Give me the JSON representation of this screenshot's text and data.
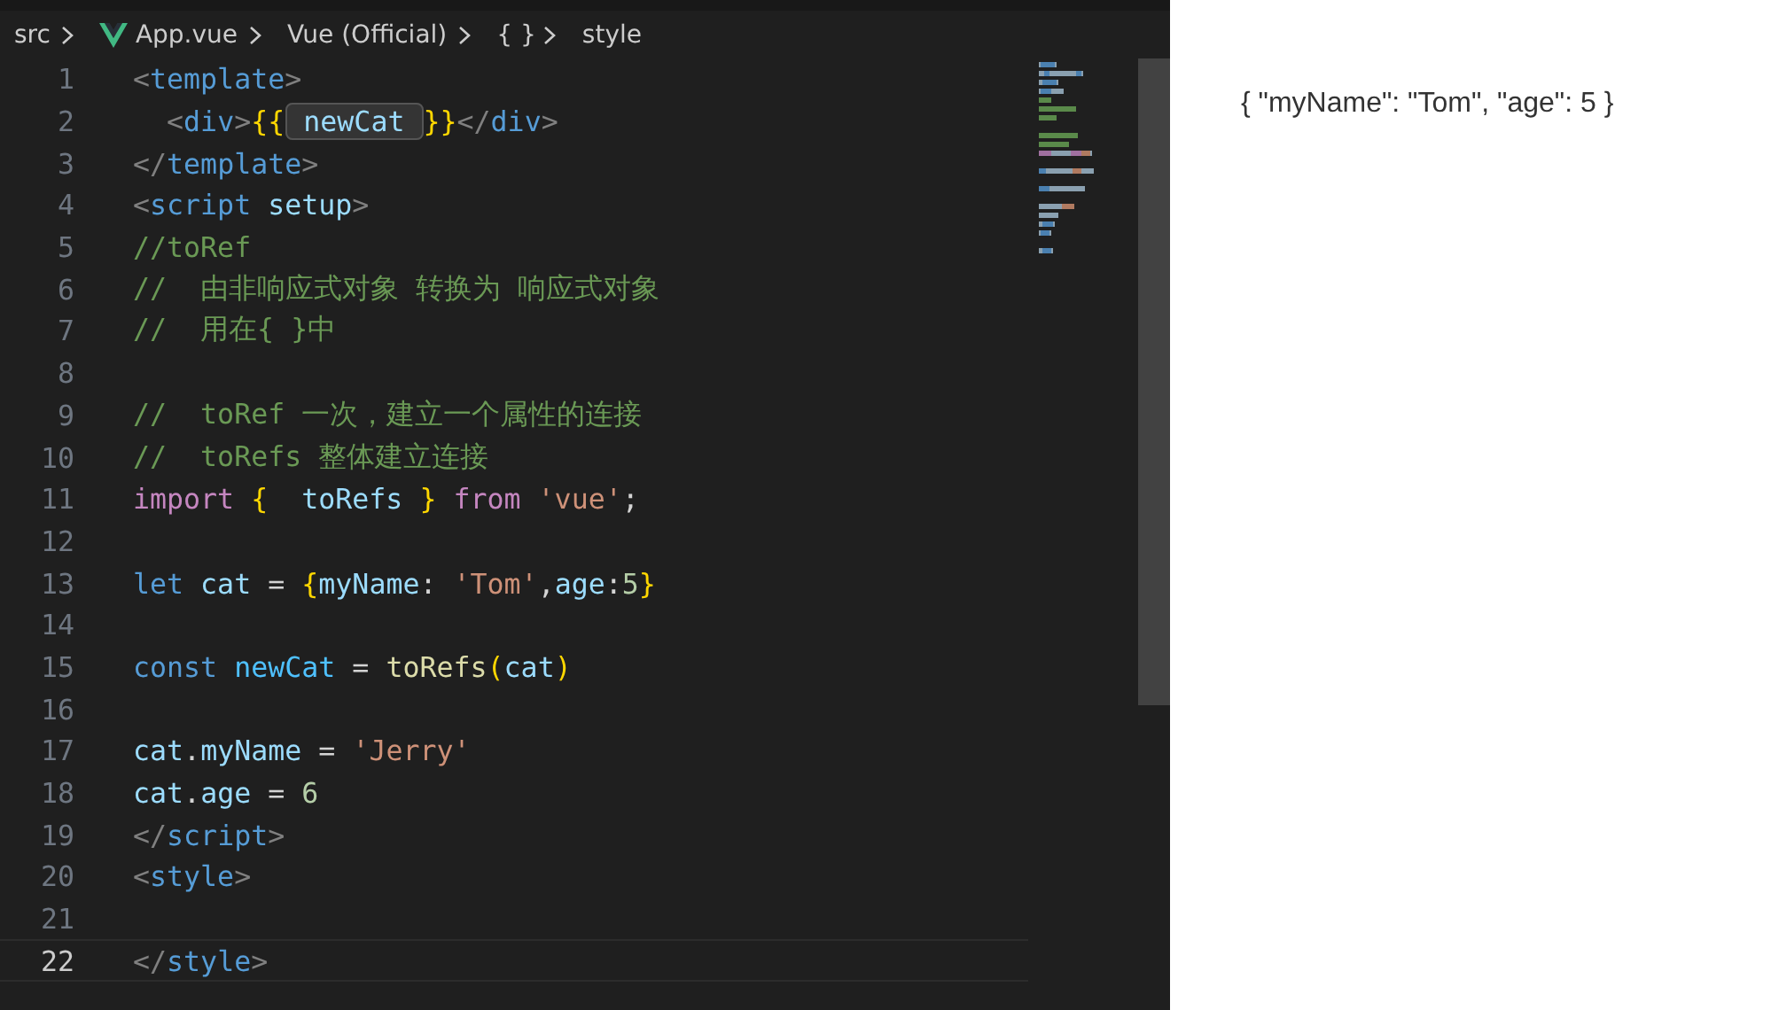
{
  "breadcrumb": [
    {
      "kind": "folder",
      "text": "src"
    },
    {
      "kind": "vue-file",
      "text": "App.vue"
    },
    {
      "kind": "plain",
      "text": "Vue (Official)"
    },
    {
      "kind": "braces",
      "text": "{ }"
    },
    {
      "kind": "plain",
      "text": "style"
    }
  ],
  "editor": {
    "lines": [
      {
        "number": "1",
        "current": false,
        "tokens": [
          {
            "kind": "tag",
            "text": "<"
          },
          {
            "kind": "tagname",
            "text": "template"
          },
          {
            "kind": "tag",
            "text": ">"
          }
        ]
      },
      {
        "number": "2",
        "current": false,
        "tokens": [
          {
            "kind": "tag",
            "text": "  <"
          },
          {
            "kind": "tagname",
            "text": "div"
          },
          {
            "kind": "tag",
            "text": ">"
          },
          {
            "kind": "brace",
            "text": "{{"
          },
          {
            "kind": "highlight",
            "text": " newCat "
          },
          {
            "kind": "brace",
            "text": "}}"
          },
          {
            "kind": "tag",
            "text": "</"
          },
          {
            "kind": "tagname",
            "text": "div"
          },
          {
            "kind": "tag",
            "text": ">"
          }
        ]
      },
      {
        "number": "3",
        "current": false,
        "tokens": [
          {
            "kind": "tag",
            "text": "</"
          },
          {
            "kind": "tagname",
            "text": "template"
          },
          {
            "kind": "tag",
            "text": ">"
          }
        ]
      },
      {
        "number": "4",
        "current": false,
        "tokens": [
          {
            "kind": "tag",
            "text": "<"
          },
          {
            "kind": "tagname",
            "text": "script"
          },
          {
            "kind": "attr",
            "text": " setup"
          },
          {
            "kind": "tag",
            "text": ">"
          }
        ]
      },
      {
        "number": "5",
        "current": false,
        "tokens": [
          {
            "kind": "comment",
            "text": "//toRef"
          }
        ]
      },
      {
        "number": "6",
        "current": false,
        "tokens": [
          {
            "kind": "comment",
            "text": "//  由非响应式对象 转换为 响应式对象"
          }
        ]
      },
      {
        "number": "7",
        "current": false,
        "tokens": [
          {
            "kind": "comment",
            "text": "//  用在{ }中"
          }
        ]
      },
      {
        "number": "8",
        "current": false
      },
      {
        "number": "9",
        "current": false,
        "tokens": [
          {
            "kind": "comment",
            "text": "//  toRef 一次，建立一个属性的连接"
          }
        ]
      },
      {
        "number": "10",
        "current": false,
        "tokens": [
          {
            "kind": "comment",
            "text": "//  toRefs 整体建立连接"
          }
        ]
      },
      {
        "number": "11",
        "current": false,
        "tokens": [
          {
            "kind": "keyword",
            "text": "import "
          },
          {
            "kind": "brace",
            "text": "{"
          },
          {
            "kind": "variable",
            "text": "  toRefs "
          },
          {
            "kind": "brace",
            "text": "}"
          },
          {
            "kind": "keyword",
            "text": " from "
          },
          {
            "kind": "string",
            "text": "'vue'"
          },
          {
            "kind": "plain",
            "text": ";"
          }
        ]
      },
      {
        "number": "12",
        "current": false
      },
      {
        "number": "13",
        "current": false,
        "tokens": [
          {
            "kind": "storage",
            "text": "let "
          },
          {
            "kind": "variable",
            "text": "cat"
          },
          {
            "kind": "plain",
            "text": " = "
          },
          {
            "kind": "brace",
            "text": "{"
          },
          {
            "kind": "variable",
            "text": "myName"
          },
          {
            "kind": "plain",
            "text": ": "
          },
          {
            "kind": "string",
            "text": "'Tom'"
          },
          {
            "kind": "plain",
            "text": ","
          },
          {
            "kind": "variable",
            "text": "age"
          },
          {
            "kind": "plain",
            "text": ":"
          },
          {
            "kind": "number",
            "text": "5"
          },
          {
            "kind": "brace",
            "text": "}"
          }
        ]
      },
      {
        "number": "14",
        "current": false
      },
      {
        "number": "15",
        "current": false,
        "tokens": [
          {
            "kind": "storage",
            "text": "const "
          },
          {
            "kind": "constant",
            "text": "newCat"
          },
          {
            "kind": "plain",
            "text": " = "
          },
          {
            "kind": "function",
            "text": "toRefs"
          },
          {
            "kind": "brace",
            "text": "("
          },
          {
            "kind": "variable",
            "text": "cat"
          },
          {
            "kind": "brace",
            "text": ")"
          }
        ]
      },
      {
        "number": "16",
        "current": false
      },
      {
        "number": "17",
        "current": false,
        "tokens": [
          {
            "kind": "variable",
            "text": "cat"
          },
          {
            "kind": "plain",
            "text": "."
          },
          {
            "kind": "variable",
            "text": "myName"
          },
          {
            "kind": "plain",
            "text": " = "
          },
          {
            "kind": "string",
            "text": "'Jerry'"
          }
        ]
      },
      {
        "number": "18",
        "current": false,
        "tokens": [
          {
            "kind": "variable",
            "text": "cat"
          },
          {
            "kind": "plain",
            "text": "."
          },
          {
            "kind": "variable",
            "text": "age"
          },
          {
            "kind": "plain",
            "text": " = "
          },
          {
            "kind": "number",
            "text": "6"
          }
        ]
      },
      {
        "number": "19",
        "current": false,
        "tokens": [
          {
            "kind": "tag",
            "text": "</"
          },
          {
            "kind": "tagname",
            "text": "script"
          },
          {
            "kind": "tag",
            "text": ">"
          }
        ]
      },
      {
        "number": "20",
        "current": false,
        "tokens": [
          {
            "kind": "tag",
            "text": "<"
          },
          {
            "kind": "tagname",
            "text": "style"
          },
          {
            "kind": "tag",
            "text": ">"
          }
        ]
      },
      {
        "number": "21",
        "current": false
      },
      {
        "number": "22",
        "current": true,
        "tokens": [
          {
            "kind": "tag",
            "text": "</"
          },
          {
            "kind": "tagname",
            "text": "style"
          },
          {
            "kind": "tag",
            "text": ">"
          }
        ]
      }
    ]
  },
  "preview": {
    "output": "{ \"myName\": \"Tom\", \"age\": 5 }"
  }
}
